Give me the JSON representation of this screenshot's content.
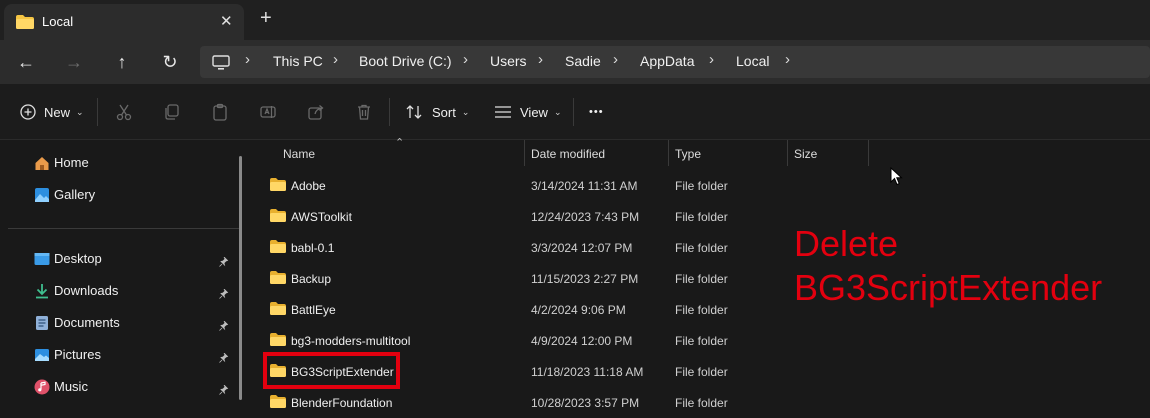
{
  "tab": {
    "title": "Local",
    "close_glyph": "✕",
    "new_tab_glyph": "+"
  },
  "nav": {
    "back": "←",
    "forward": "→",
    "up": "↑",
    "refresh": "↻"
  },
  "breadcrumb": {
    "separator": "›",
    "items": [
      "This PC",
      "Boot Drive (C:)",
      "Users",
      "Sadie",
      "AppData",
      "Local"
    ]
  },
  "toolbar": {
    "new_label": "New",
    "sort_label": "Sort",
    "view_label": "View",
    "more_glyph": "•••",
    "icons": [
      "cut-icon",
      "copy-icon",
      "paste-icon",
      "rename-icon",
      "share-icon",
      "delete-icon"
    ]
  },
  "sidebar": {
    "top_items": [
      {
        "label": "Home",
        "icon": "home-icon"
      },
      {
        "label": "Gallery",
        "icon": "gallery-icon"
      }
    ],
    "quick_access": [
      {
        "label": "Desktop",
        "icon": "desktop-icon"
      },
      {
        "label": "Downloads",
        "icon": "downloads-icon"
      },
      {
        "label": "Documents",
        "icon": "documents-icon"
      },
      {
        "label": "Pictures",
        "icon": "pictures-icon"
      },
      {
        "label": "Music",
        "icon": "music-icon"
      }
    ]
  },
  "columns": {
    "name": "Name",
    "date": "Date modified",
    "type": "Type",
    "size": "Size"
  },
  "files": [
    {
      "name": "Adobe",
      "date": "3/14/2024 11:31 AM",
      "type": "File folder"
    },
    {
      "name": "AWSToolkit",
      "date": "12/24/2023 7:43 PM",
      "type": "File folder"
    },
    {
      "name": "babl-0.1",
      "date": "3/3/2024 12:07 PM",
      "type": "File folder"
    },
    {
      "name": "Backup",
      "date": "11/15/2023 2:27 PM",
      "type": "File folder"
    },
    {
      "name": "BattlEye",
      "date": "4/2/2024 9:06 PM",
      "type": "File folder"
    },
    {
      "name": "bg3-modders-multitool",
      "date": "4/9/2024 12:00 PM",
      "type": "File folder"
    },
    {
      "name": "BG3ScriptExtender",
      "date": "11/18/2023 11:18 AM",
      "type": "File folder"
    },
    {
      "name": "BlenderFoundation",
      "date": "10/28/2023 3:57 PM",
      "type": "File folder"
    }
  ],
  "annotation": {
    "line1": "Delete",
    "line2": "BG3ScriptExtender",
    "color": "#e3000f"
  },
  "colors": {
    "folder": "#f5c543",
    "accent": "#4aa3e8"
  }
}
